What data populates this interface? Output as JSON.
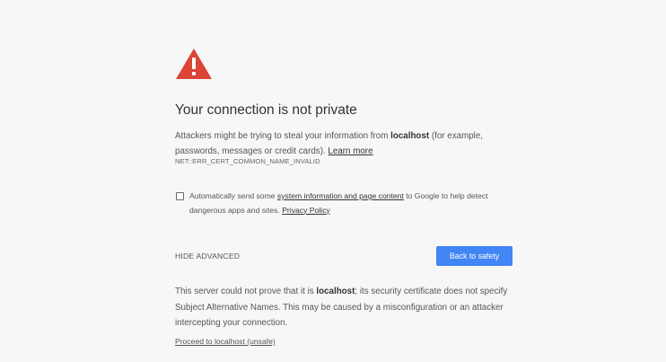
{
  "title": "Your connection is not private",
  "description": {
    "part1": "Attackers might be trying to steal your information from ",
    "host": "localhost",
    "part2": " (for example, passwords, messages or credit cards). ",
    "learn_more": "Learn more"
  },
  "error_code": "NET::ERR_CERT_COMMON_NAME_INVALID",
  "optin": {
    "checked": false,
    "part1": "Automatically send some ",
    "link1": "system information and page content",
    "part2": " to Google to help detect dangerous apps and sites. ",
    "link2": "Privacy Policy"
  },
  "hide_advanced": "HIDE ADVANCED",
  "primary_button": "Back to safety",
  "details": {
    "part1": "This server could not prove that it is ",
    "host": "localhost",
    "part2": "; its security certificate does not specify Subject Alternative Names. This may be caused by a misconfiguration or an attacker intercepting your connection."
  },
  "proceed_link": "Proceed to localhost (unsafe)",
  "colors": {
    "background": "#f7f7f7",
    "warning_red": "#db4437",
    "primary_blue": "#4285f4",
    "text": "#333333"
  }
}
